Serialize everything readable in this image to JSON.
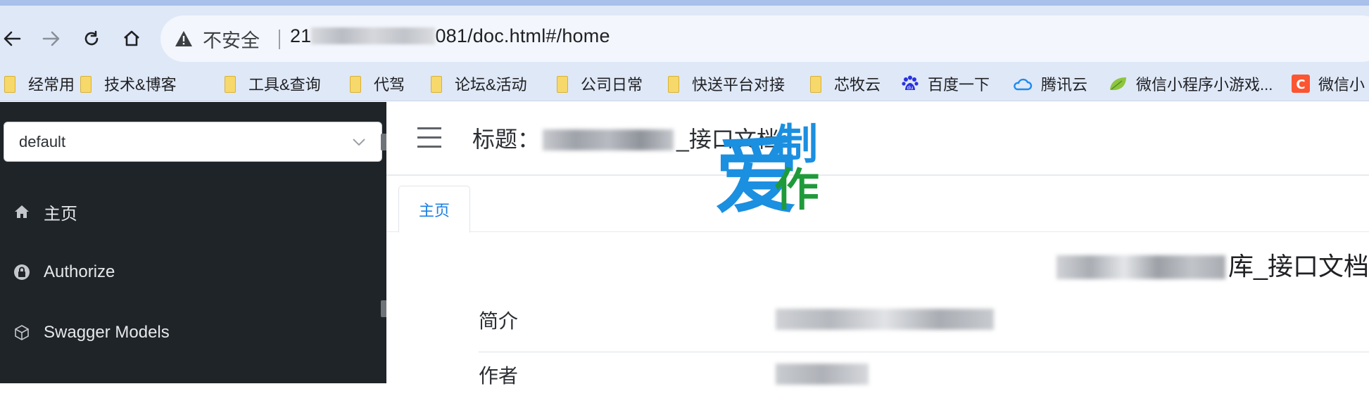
{
  "browser": {
    "insecure_label": "不安全",
    "url_prefix": "21",
    "url_suffix": "081/doc.html#/home",
    "bookmarks": [
      {
        "label": "经常用",
        "icon": "folder-icon"
      },
      {
        "label": "技术&博客",
        "icon": "folder-icon"
      },
      {
        "label": "工具&查询",
        "icon": "folder-icon"
      },
      {
        "label": "代驾",
        "icon": "folder-icon"
      },
      {
        "label": "论坛&活动",
        "icon": "folder-icon"
      },
      {
        "label": "公司日常",
        "icon": "folder-icon"
      },
      {
        "label": "快送平台对接",
        "icon": "folder-icon"
      },
      {
        "label": "芯牧云",
        "icon": "folder-icon"
      },
      {
        "label": "百度一下",
        "icon": "baidu-icon"
      },
      {
        "label": "腾讯云",
        "icon": "tencent-cloud-icon"
      },
      {
        "label": "微信小程序小游戏...",
        "icon": "leaf-icon"
      },
      {
        "label": "微信小",
        "icon": "csdn-icon"
      }
    ]
  },
  "sidebar": {
    "group_select_value": "default",
    "menu": [
      {
        "label": "主页",
        "icon": "home-icon"
      },
      {
        "label": "Authorize",
        "icon": "lock-icon"
      },
      {
        "label": "Swagger Models",
        "icon": "cube-icon"
      }
    ]
  },
  "header": {
    "title_label": "标题：",
    "title_suffix": "_接口文档"
  },
  "watermark": {
    "text_top": "制",
    "text_left": "爱",
    "text_bottom": "作",
    "colors": [
      "#1b8fe0",
      "#1f9a3a"
    ]
  },
  "tabs": [
    {
      "label": "主页"
    }
  ],
  "doc": {
    "title_suffix": "库_接口文档",
    "rows": [
      {
        "key": "简介"
      },
      {
        "key": "作者"
      }
    ]
  },
  "colors": {
    "accent": "#1a7fe0",
    "sidebar_bg": "#1f2428",
    "chrome_bg": "#dfe8f7"
  }
}
